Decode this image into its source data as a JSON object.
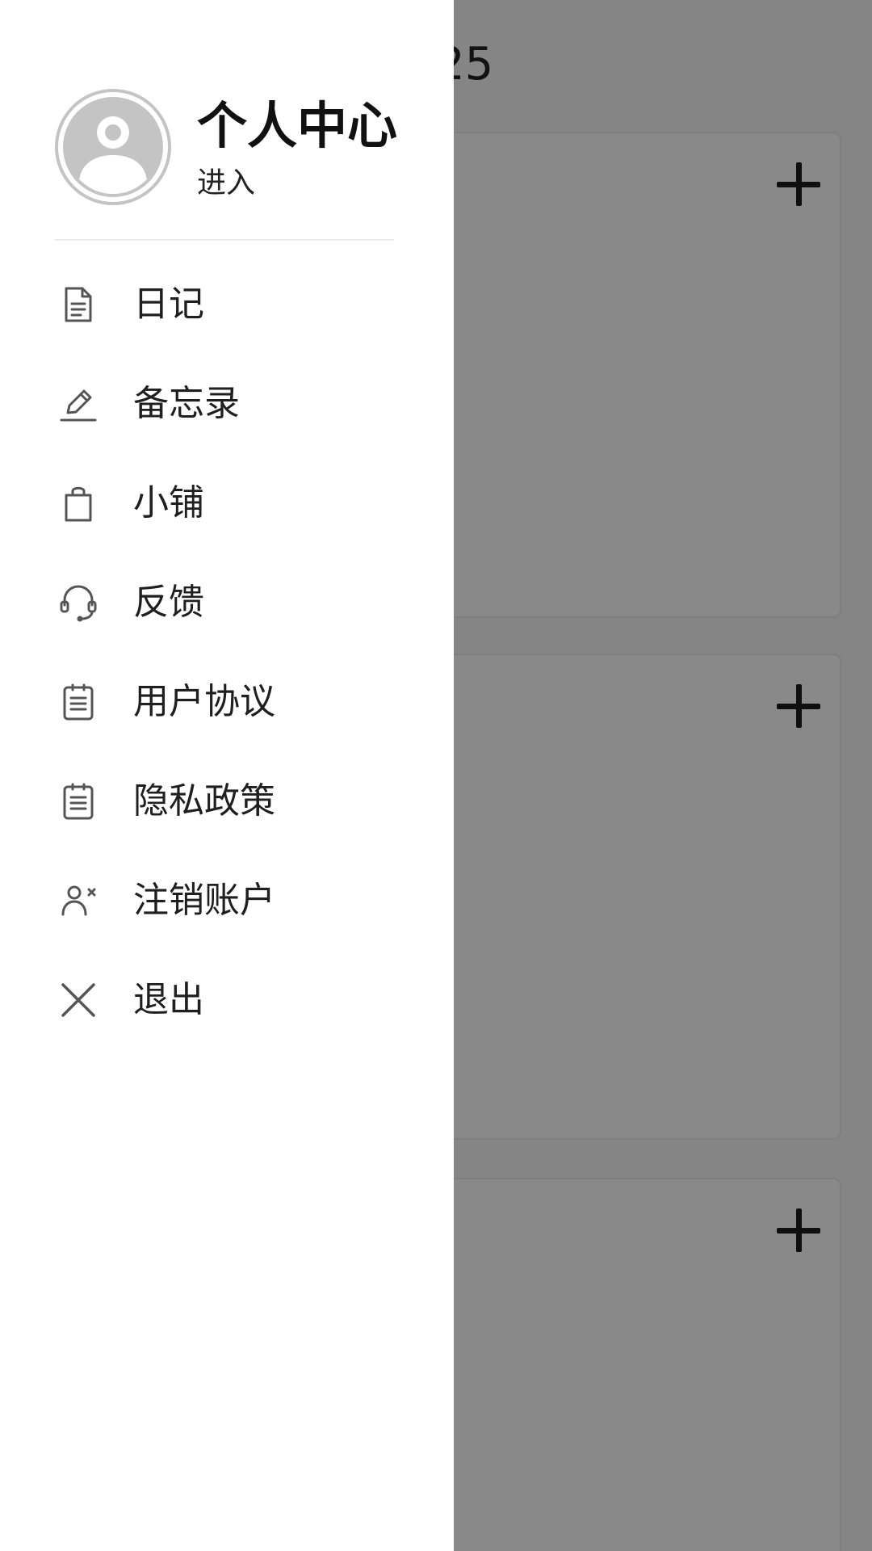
{
  "background": {
    "header_partial_title": "25",
    "cards": [
      {
        "add_label": "+"
      },
      {
        "add_label": "+"
      },
      {
        "add_label": "+"
      }
    ]
  },
  "drawer": {
    "profile": {
      "title": "个人中心",
      "subtitle": "进入"
    },
    "menu": [
      {
        "label": "日记",
        "icon": "document-icon"
      },
      {
        "label": "备忘录",
        "icon": "pencil-icon"
      },
      {
        "label": "小铺",
        "icon": "shopping-bag-icon"
      },
      {
        "label": "反馈",
        "icon": "headset-icon"
      },
      {
        "label": "用户协议",
        "icon": "clipboard-list-icon"
      },
      {
        "label": "隐私政策",
        "icon": "clipboard-list-icon"
      },
      {
        "label": "注销账户",
        "icon": "user-remove-icon"
      },
      {
        "label": "退出",
        "icon": "close-icon"
      }
    ]
  },
  "colors": {
    "drawer_bg": "#ffffff",
    "overlay": "rgba(0,0,0,0.45)",
    "text_primary": "#1f1f1f",
    "icon": "#555555",
    "avatar": "#c4c4c4"
  }
}
